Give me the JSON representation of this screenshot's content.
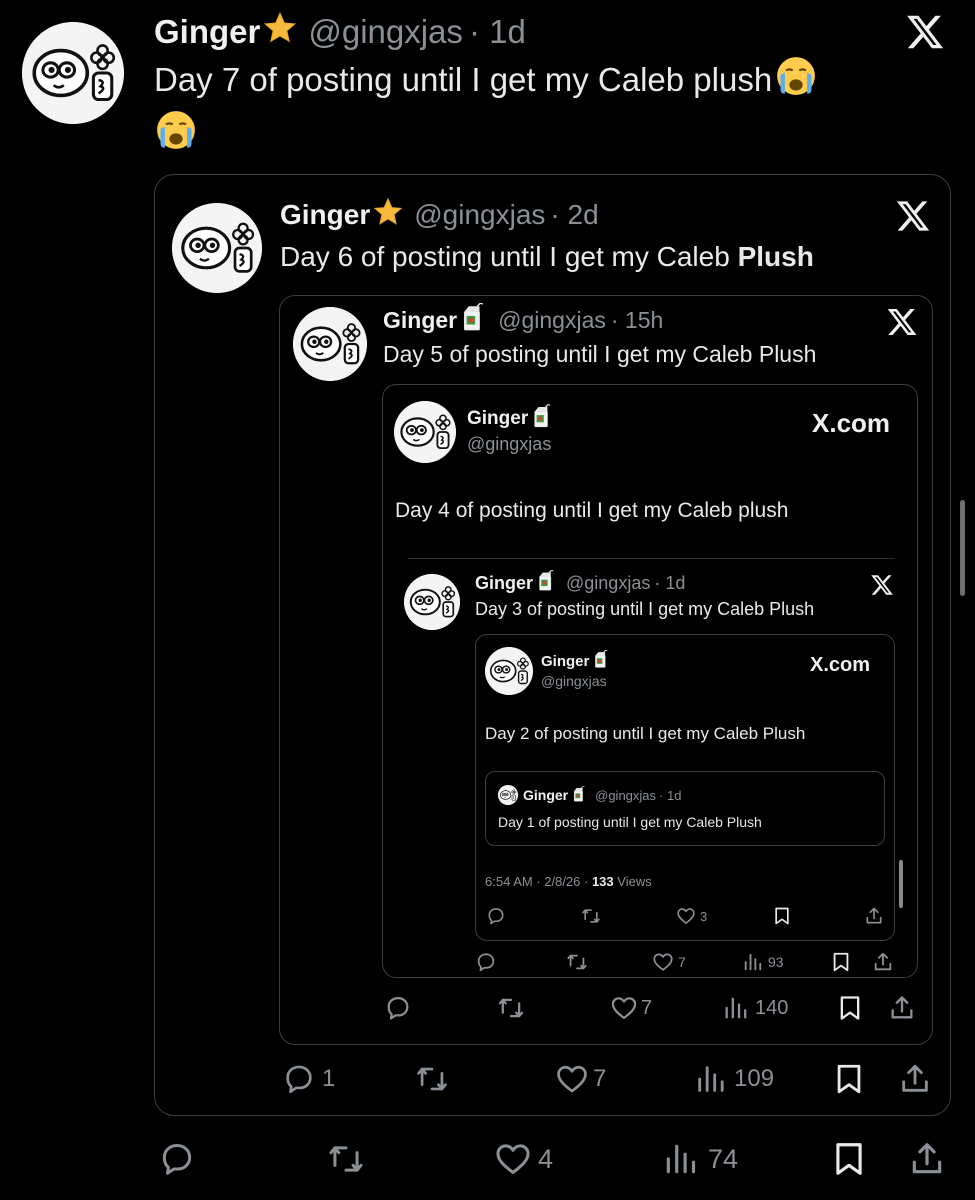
{
  "colors": {
    "background": "#000000",
    "name": "#f0f0f0",
    "muted": "#8b9096",
    "border": "#3a3d40",
    "star": "#f6b93b",
    "cry_emoji": "#ffcc4d",
    "tear": "#5dadec"
  },
  "post_day7": {
    "name": "Ginger",
    "handle": "@gingxjas",
    "time": "· 1d",
    "text": "Day 7 of posting until I get my Caleb plush",
    "actions": {
      "reply": "",
      "retweet": "",
      "like": "4",
      "views": "74"
    }
  },
  "quote_day6": {
    "name": "Ginger",
    "handle": "@gingxjas",
    "time": "· 2d",
    "text_prefix": "Day 6 of posting until I get my Caleb ",
    "text_bold": "Plush",
    "actions": {
      "reply": "1",
      "retweet": "",
      "like": "7",
      "views": "109"
    }
  },
  "quote_day5": {
    "name": "Ginger",
    "handle": "@gingxjas",
    "time": "· 15h",
    "text": "Day 5 of posting until I get my Caleb Plush",
    "actions": {
      "reply": "",
      "retweet": "",
      "like": "7",
      "views": "140"
    }
  },
  "card_day4": {
    "name": "Ginger",
    "handle": "@gingxjas",
    "brand": "X.com",
    "text": "Day 4 of posting until I get my Caleb plush",
    "actions": {
      "reply": "",
      "retweet": "",
      "like": "7",
      "views": "93"
    }
  },
  "quote_day3": {
    "name": "Ginger",
    "handle": "@gingxjas",
    "time": "· 1d",
    "text": "Day 3 of posting until I get my Caleb Plush"
  },
  "card_day2": {
    "name": "Ginger",
    "handle": "@gingxjas",
    "brand": "X.com",
    "text": "Day 2 of posting until I get my Caleb Plush",
    "meta_time": "6:54 AM · 2/8/26 · ",
    "meta_views_count": "133",
    "meta_views_label": " Views",
    "actions": {
      "like": "3"
    }
  },
  "quote_day1": {
    "name": "Ginger",
    "handle": "@gingxjas",
    "time": "· 1d",
    "text": "Day 1 of posting until I get my Caleb Plush"
  },
  "icons": [
    "avatar-face",
    "star-icon",
    "crying-face-icon",
    "juice-box-icon",
    "x-logo-icon",
    "reply-icon",
    "retweet-icon",
    "like-icon",
    "views-icon",
    "bookmark-icon",
    "share-icon"
  ]
}
